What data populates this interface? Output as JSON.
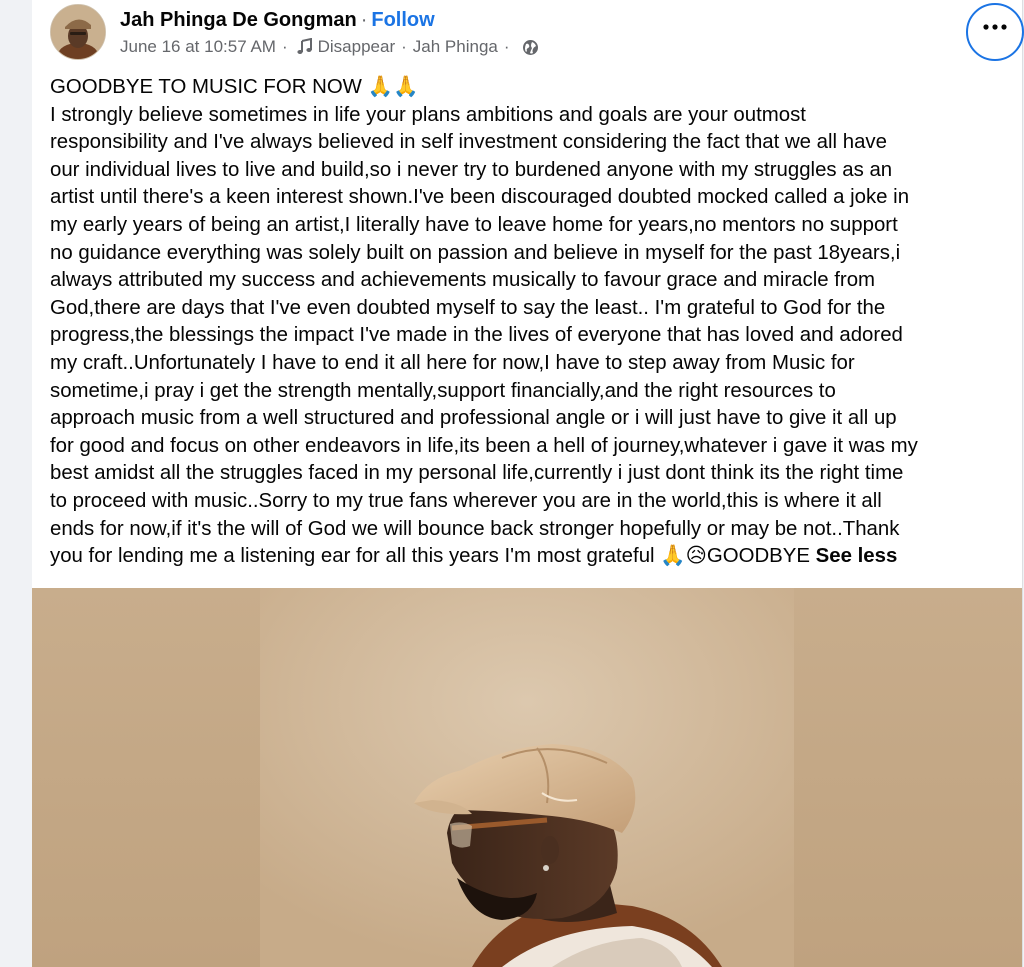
{
  "post": {
    "author": {
      "name": "Jah Phinga De Gongman",
      "separator": "·",
      "follow_label": "Follow"
    },
    "meta": {
      "timestamp": "June 16 at 10:57 AM",
      "sep1": "·",
      "music_icon": "music-note-icon",
      "song": "Disappear",
      "sep2": "·",
      "artist": "Jah Phinga",
      "sep3": "·",
      "privacy_icon": "globe-icon"
    },
    "more_icon": "more-options-icon",
    "text_lines": [
      "GOODBYE TO MUSIC FOR NOW 🙏🙏",
      "I strongly believe sometimes in life your plans ambitions and goals are your outmost",
      "responsibility and I've always believed in self investment considering the fact that we all have",
      "our individual lives to live and build,so i never try to burdened anyone with my struggles as an",
      "artist until there's a keen interest shown.I've been discouraged doubted mocked called a joke in",
      "my early years of being an artist,I literally have to leave home for years,no mentors no support",
      "no guidance everything was solely built on passion and believe in myself for the past 18years,i",
      "always attributed my success and achievements musically to favour grace and miracle from",
      "God,there are days that I've even doubted myself to say the least.. I'm grateful to God for the",
      "progress,the blessings the impact I've made in the lives of everyone that has loved and adored",
      "my craft..Unfortunately I have to end it all here for now,I have to step away from Music for",
      "sometime,i pray i get the strength mentally,support financially,and the right resources to",
      "approach music from a well structured and professional angle or i will just have to give it all up",
      "for good and focus on other endeavors in life,its been a hell of journey,whatever i gave it was my",
      "best amidst all the struggles faced in my personal life,currently i just dont think its the right time",
      "to proceed with music..Sorry to my true fans wherever you are in the world,this is where it all",
      "ends for now,if it's the will of God we will bounce back stronger hopefully or may be not..Thank"
    ],
    "last_line": "you for lending me a listening ear for all this years I'm most grateful 🙏😥GOODBYE",
    "see_less_label": "See less"
  },
  "colors": {
    "link_blue": "#1b74e4",
    "text_primary": "#050505",
    "text_secondary": "#65676b",
    "photo_backdrop": "#c4a98a"
  }
}
